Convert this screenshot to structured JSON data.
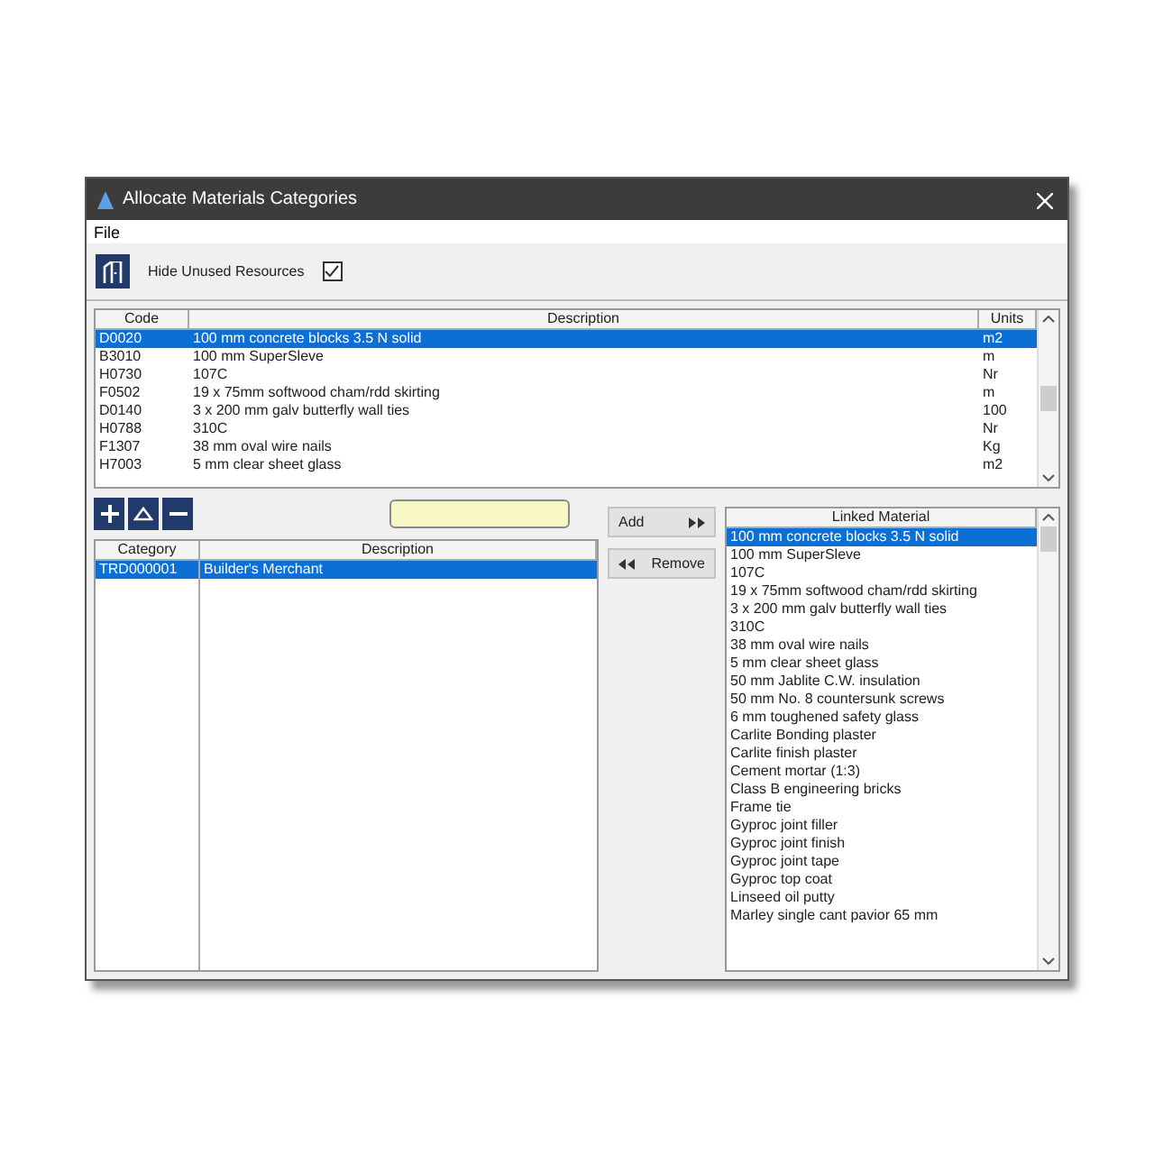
{
  "window": {
    "title": "Allocate Materials Categories"
  },
  "menu": [
    "File"
  ],
  "toolbar": {
    "hide_unused": {
      "label": "Hide Unused Resources",
      "checked": true
    }
  },
  "resources": {
    "columns": [
      "Code",
      "Description",
      "Units"
    ],
    "rows": [
      {
        "code": "D0020",
        "description": "100 mm concrete blocks 3.5 N solid",
        "units": "m2",
        "selected": true
      },
      {
        "code": "B3010",
        "description": "100 mm SuperSleve",
        "units": "m",
        "selected": false
      },
      {
        "code": "H0730",
        "description": "107C",
        "units": "Nr",
        "selected": false
      },
      {
        "code": "F0502",
        "description": "19 x 75mm softwood cham/rdd skirting",
        "units": "m",
        "selected": false
      },
      {
        "code": "D0140",
        "description": "3 x 200 mm galv butterfly wall ties",
        "units": "100",
        "selected": false
      },
      {
        "code": "H0788",
        "description": "310C",
        "units": "Nr",
        "selected": false
      },
      {
        "code": "F1307",
        "description": "38 mm oval wire nails",
        "units": "Kg",
        "selected": false
      },
      {
        "code": "H7003",
        "description": "5 mm clear sheet glass",
        "units": "m2",
        "selected": false
      }
    ]
  },
  "categories": {
    "columns": [
      "Category",
      "Description"
    ],
    "rows": [
      {
        "category": "TRD000001",
        "description": "Builder's Merchant",
        "selected": true
      }
    ]
  },
  "buttons": {
    "add": "Add",
    "remove": "Remove"
  },
  "linked": {
    "header": "Linked Material",
    "items": [
      {
        "label": "100 mm concrete blocks 3.5 N solid",
        "selected": true
      },
      {
        "label": "100 mm SuperSleve",
        "selected": false
      },
      {
        "label": "107C",
        "selected": false
      },
      {
        "label": "19 x 75mm softwood cham/rdd skirting",
        "selected": false
      },
      {
        "label": "3 x 200 mm galv butterfly wall ties",
        "selected": false
      },
      {
        "label": "310C",
        "selected": false
      },
      {
        "label": "38 mm oval wire nails",
        "selected": false
      },
      {
        "label": "5 mm clear sheet glass",
        "selected": false
      },
      {
        "label": "50 mm Jablite C.W. insulation",
        "selected": false
      },
      {
        "label": "50 mm No. 8 countersunk screws",
        "selected": false
      },
      {
        "label": "6 mm toughened safety glass",
        "selected": false
      },
      {
        "label": "Carlite Bonding plaster",
        "selected": false
      },
      {
        "label": "Carlite finish plaster",
        "selected": false
      },
      {
        "label": "Cement mortar (1:3)",
        "selected": false
      },
      {
        "label": "Class B engineering bricks",
        "selected": false
      },
      {
        "label": "Frame tie",
        "selected": false
      },
      {
        "label": "Gyproc joint filler",
        "selected": false
      },
      {
        "label": "Gyproc joint finish",
        "selected": false
      },
      {
        "label": "Gyproc joint tape",
        "selected": false
      },
      {
        "label": "Gyproc top coat",
        "selected": false
      },
      {
        "label": "Linseed oil putty",
        "selected": false
      },
      {
        "label": "Marley single cant pavior 65 mm",
        "selected": false
      }
    ]
  }
}
